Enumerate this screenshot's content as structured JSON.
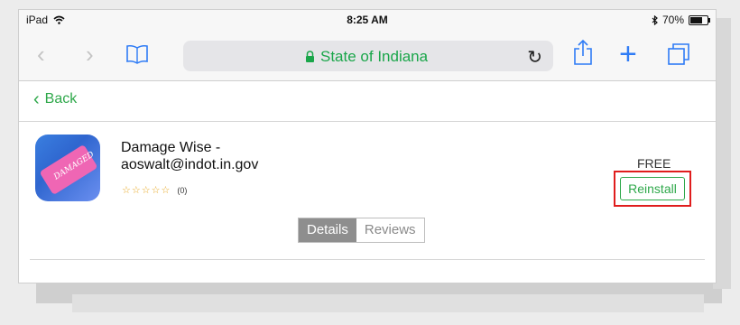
{
  "status_bar": {
    "device": "iPad",
    "time": "8:25 AM",
    "battery": "70%",
    "battery_level": 0.7
  },
  "toolbar": {
    "address": "State of Indiana",
    "icons": [
      "back-arrow-icon",
      "forward-arrow-icon",
      "bookmarks-icon",
      "lock-icon",
      "reload-icon",
      "share-icon",
      "add-icon",
      "tabs-icon"
    ]
  },
  "nav": {
    "back_label": "Back"
  },
  "app": {
    "title_line1": "Damage Wise -",
    "title_line2": "aoswalt@indot.in.gov",
    "icon_text": "DAMAGED",
    "stars": "☆☆☆☆☆",
    "rating_count": "(0)",
    "price": "FREE",
    "action_label": "Reinstall"
  },
  "tabs": [
    "Details",
    "Reviews"
  ],
  "colors": {
    "accent_green": "#2ea84a",
    "ios_blue": "#2f7cf6",
    "highlight_red": "#e01d1d"
  }
}
